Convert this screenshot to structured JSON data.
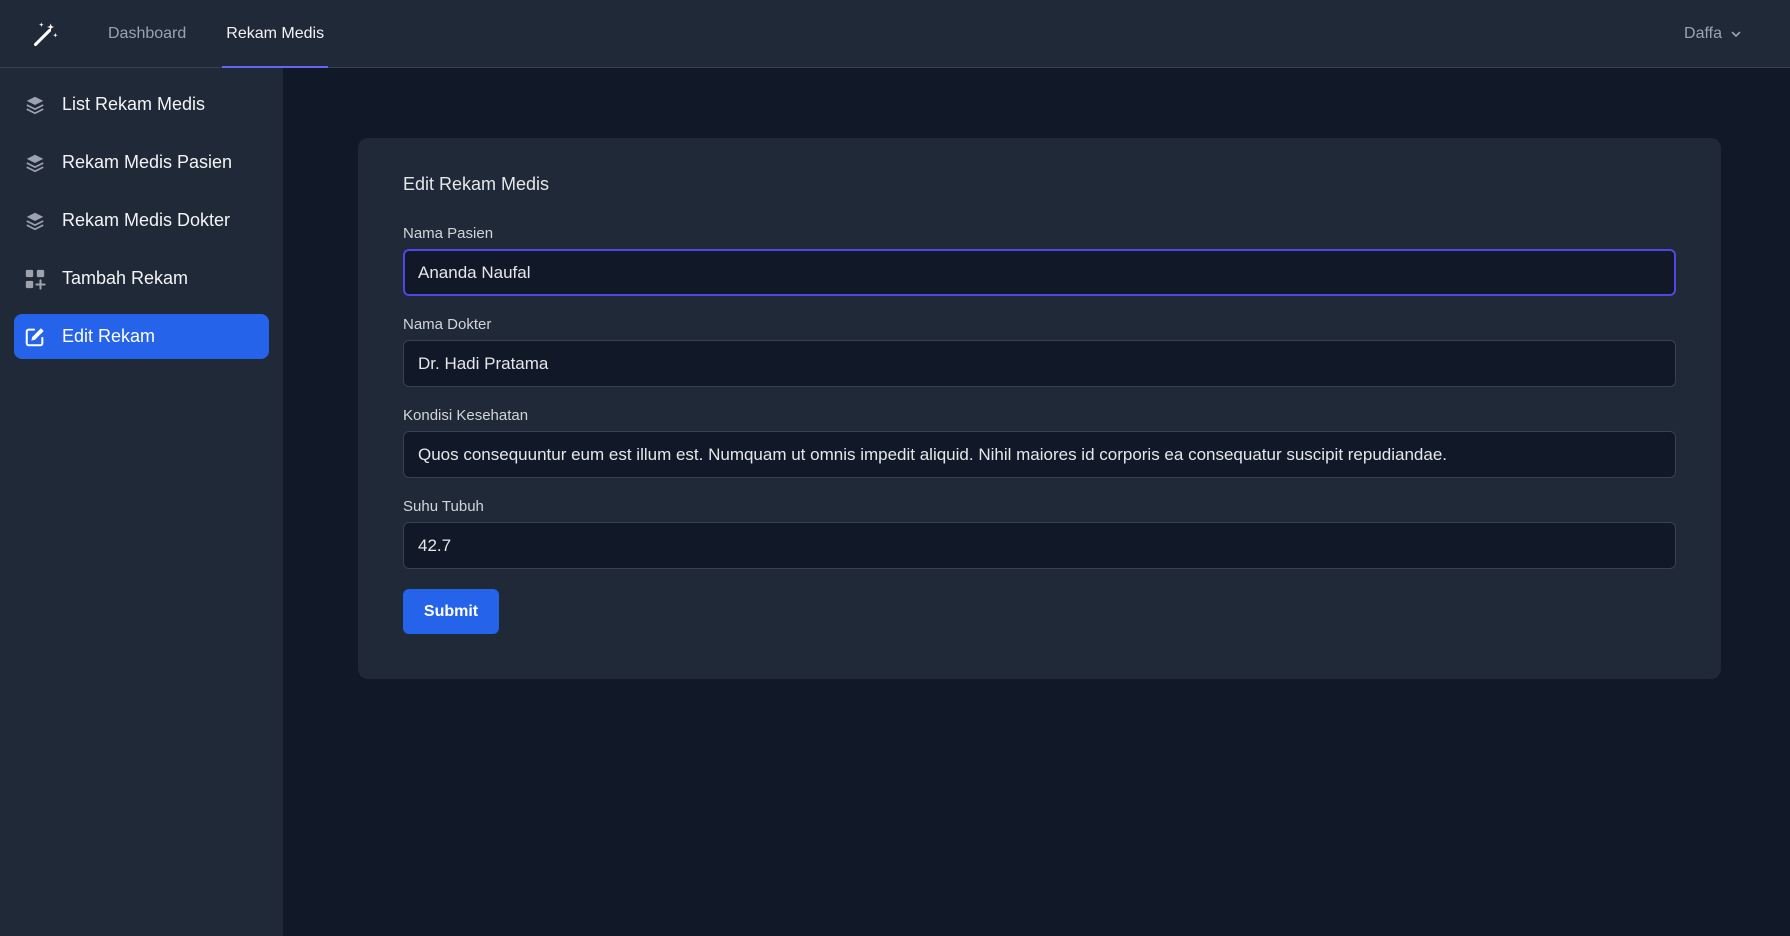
{
  "topnav": {
    "logo_icon": "magic-wand-icon",
    "tabs": [
      {
        "label": "Dashboard",
        "active": false
      },
      {
        "label": "Rekam Medis",
        "active": true
      }
    ],
    "user": {
      "name": "Daffa",
      "icon": "chevron-down-icon"
    }
  },
  "sidebar": {
    "items": [
      {
        "label": "List Rekam Medis",
        "icon": "layers-icon",
        "active": false
      },
      {
        "label": "Rekam Medis Pasien",
        "icon": "layers-icon",
        "active": false
      },
      {
        "label": "Rekam Medis Dokter",
        "icon": "layers-icon",
        "active": false
      },
      {
        "label": "Tambah Rekam",
        "icon": "add-grid-icon",
        "active": false
      },
      {
        "label": "Edit Rekam",
        "icon": "edit-icon",
        "active": true
      }
    ]
  },
  "form": {
    "title": "Edit Rekam Medis",
    "fields": [
      {
        "label": "Nama Pasien",
        "value": "Ananda Naufal"
      },
      {
        "label": "Nama Dokter",
        "value": "Dr. Hadi Pratama"
      },
      {
        "label": "Kondisi Kesehatan",
        "value": "Quos consequuntur eum est illum est. Numquam ut omnis impedit aliquid. Nihil maiores id corporis ea consequatur suscipit repudiandae."
      },
      {
        "label": "Suhu Tubuh",
        "value": "42.7"
      }
    ],
    "submit_label": "Submit"
  },
  "colors": {
    "background": "#111827",
    "panel": "#1f2937",
    "accent": "#2563eb",
    "focus": "#4f46e5"
  }
}
